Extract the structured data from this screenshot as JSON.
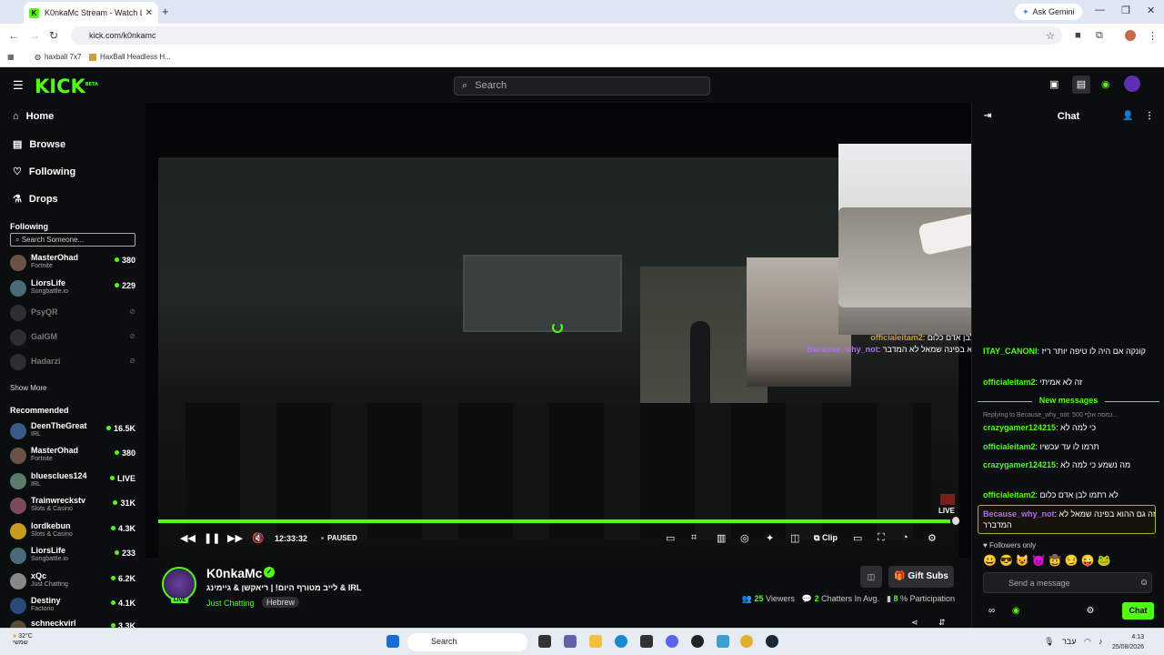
{
  "browser": {
    "tab_title": "K0nkaMc Stream - Watch Live o",
    "tab_favicon": "K",
    "new_tab_icon": "+",
    "ask_gemini": "Ask Gemini",
    "url": "kick.com/k0nkamc",
    "bookmarks": [
      "haxball 7x7",
      "HaxBall Headless H..."
    ]
  },
  "kick_header": {
    "logo": "KICK",
    "logo_badge": "BETA",
    "search_placeholder": "Search"
  },
  "sidebar": {
    "nav": [
      {
        "label": "Home",
        "icon": "home-icon"
      },
      {
        "label": "Browse",
        "icon": "browse-icon"
      },
      {
        "label": "Following",
        "icon": "heart-icon"
      },
      {
        "label": "Drops",
        "icon": "drops-icon"
      }
    ],
    "following_heading": "Following",
    "search_placeholder": "Search Someone...",
    "following": [
      {
        "name": "MasterOhad",
        "category": "Fortnite",
        "viewers": "380"
      },
      {
        "name": "LiorsLife",
        "category": "Songbattle.io",
        "viewers": "229"
      },
      {
        "name": "PsyQR",
        "offline": true
      },
      {
        "name": "GalGM",
        "offline": true
      },
      {
        "name": "Hadarzi",
        "offline": true
      }
    ],
    "show_more": "Show More",
    "recommended_heading": "Recommended",
    "recommended": [
      {
        "name": "DeenTheGreat",
        "category": "IRL",
        "viewers": "16.5K"
      },
      {
        "name": "MasterOhad",
        "category": "Fortnite",
        "viewers": "380"
      },
      {
        "name": "bluesclues124",
        "category": "IRL",
        "viewers": "LIVE"
      },
      {
        "name": "Trainwreckstv",
        "category": "Slots & Casino",
        "viewers": "31K"
      },
      {
        "name": "lordkebun",
        "category": "Slots & Casino",
        "viewers": "4.3K"
      },
      {
        "name": "LiorsLife",
        "category": "Songbattle.io",
        "viewers": "233"
      },
      {
        "name": "xQc",
        "category": "Just Chatting",
        "viewers": "6.2K"
      },
      {
        "name": "Destiny",
        "category": "Factorio",
        "viewers": "4.1K"
      },
      {
        "name": "schneckvirl",
        "category": "",
        "viewers": "3.3K"
      }
    ]
  },
  "player": {
    "time": "12:33:32",
    "state": "PAUSED",
    "live_label": "LIVE",
    "clip_label": "Clip",
    "progress_fraction": 0.99
  },
  "stream_info": {
    "streamer": "K0nkaMc",
    "live_tag": "LIVE",
    "title": "לייב מטורף היום! | ריאקשן & גיימינג & IRL",
    "category": "Just Chatting",
    "language": "Hebrew",
    "gift_subs": "Gift Subs",
    "viewers_value": "25",
    "viewers_label": "Viewers",
    "chatters_value": "2",
    "chatters_label": "Chatters In Avg.",
    "participation_value": "8",
    "participation_label": "% Participation"
  },
  "chat": {
    "title": "Chat",
    "messages": [
      {
        "user": "ITAY_CANONI",
        "color": "#53fc18",
        "text": "קונקה אם היה לו טיפה יותר ריז"
      },
      {
        "user": "officialeitam2",
        "color": "#53fc18",
        "text": "זה לא אמיתי"
      }
    ],
    "new_messages": "New messages",
    "reply_to": "Replying to Because_why_not: 500 נמסה אלף...",
    "messages2": [
      {
        "user": "crazygamer124215",
        "color": "#53fc18",
        "text": "כי למה לא"
      },
      {
        "user": "officialeitam2",
        "color": "#53fc18",
        "text": "תרמו לו עד עכשיו"
      },
      {
        "user": "crazygamer124215",
        "color": "#53fc18",
        "text": "מה נשמע כי למה לא"
      },
      {
        "user": "officialeitam2",
        "color": "#53fc18",
        "text": "לא רתמו לבן אדם כלום"
      },
      {
        "user": "Because_why_not",
        "color": "#b06cf5",
        "text": "זה גם ההוא בפינה שמאל לא המדברר"
      }
    ],
    "followers_only": "Followers only",
    "send_placeholder": "Send a message",
    "chat_button": "Chat"
  },
  "video_overlay_chat": [
    {
      "user": "officialeitam2",
      "text": "לא רתמו לבן אדם כלום"
    },
    {
      "user": "Because_why_not",
      "text": "זה גם ההוא בפינה שמאל לא המדבר"
    }
  ],
  "taskbar": {
    "temperature": "32°C",
    "weather_text": "שמשי",
    "search": "Search",
    "time": "4:13",
    "date": "25/08/2026",
    "lang": "עבר"
  }
}
